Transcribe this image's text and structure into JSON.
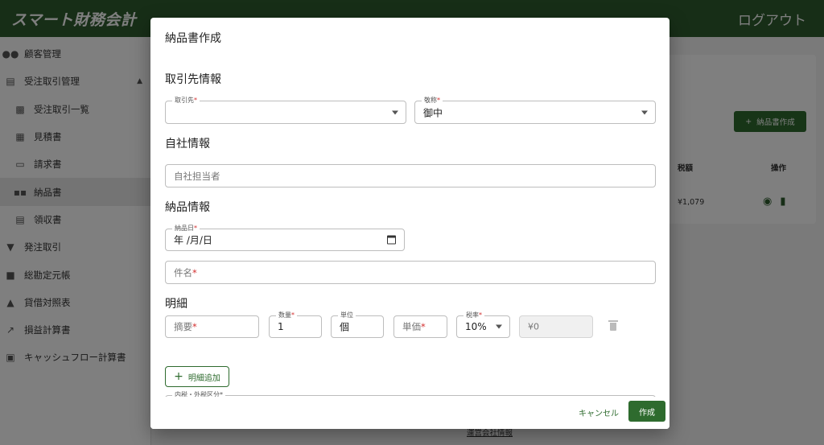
{
  "app": {
    "brand": "スマート財務会計",
    "logout": "ログアウト"
  },
  "sidebar": {
    "items": [
      {
        "label": "顧客管理",
        "icon": "people-icon"
      },
      {
        "label": "受注取引管理",
        "icon": "list-icon",
        "expanded": true
      },
      {
        "label": "受注取引一覧",
        "icon": "clipboard-icon"
      },
      {
        "label": "見積書",
        "icon": "document-icon"
      },
      {
        "label": "請求書",
        "icon": "credit-card-icon"
      },
      {
        "label": "納品書",
        "icon": "truck-icon",
        "active": true
      },
      {
        "label": "領収書",
        "icon": "receipt-icon"
      },
      {
        "label": "発注取引",
        "icon": "cart-icon"
      },
      {
        "label": "総勘定元帳",
        "icon": "book-icon"
      },
      {
        "label": "貸借対照表",
        "icon": "bank-icon"
      },
      {
        "label": "損益計算書",
        "icon": "trending-up-icon"
      },
      {
        "label": "キャッシュフロー計算書",
        "icon": "wallet-icon"
      }
    ]
  },
  "background": {
    "create_button": "納品書作成",
    "table_headers": {
      "tax": "税額",
      "actions": "操作"
    },
    "row": {
      "tax": "¥1,079"
    },
    "footer_link": "運営会社情報"
  },
  "dialog": {
    "title": "納品書作成",
    "sections": {
      "client": "取引先情報",
      "company": "自社情報",
      "delivery": "納品情報",
      "details": "明細"
    },
    "client_field": {
      "label": "取引先",
      "value": ""
    },
    "honorific_field": {
      "label": "敬称",
      "value": "御中"
    },
    "staff_field": {
      "placeholder": "自社担当者"
    },
    "date_field": {
      "label": "納品日",
      "value": "年 /月/日"
    },
    "subject_field": {
      "placeholder": "件名"
    },
    "line_item": {
      "summary_placeholder": "摘要",
      "quantity_label": "数量",
      "quantity_value": "1",
      "unit_label": "単位",
      "unit_value": "個",
      "price_placeholder": "単価",
      "tax_rate_label": "税率",
      "tax_rate_value": "10%",
      "amount_value": "¥0"
    },
    "add_line_button": "明細追加",
    "tax_type_label": "内税・外税区分",
    "cancel_button": "キャンセル",
    "create_button": "作成"
  },
  "colors": {
    "primary": "#2e6b2e",
    "appbar": "#2e5c2e",
    "required": "#d32f2f"
  }
}
